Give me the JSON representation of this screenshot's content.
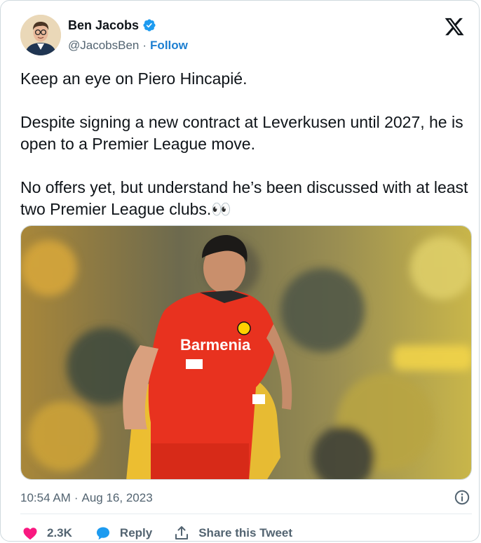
{
  "author": {
    "name": "Ben Jacobs",
    "handle": "@JacobsBen",
    "separator": "·",
    "follow_label": "Follow",
    "verified_color": "#1d9bf0"
  },
  "tweet": {
    "paragraphs": [
      "Keep an eye on Piero Hincapié.",
      "Despite signing a new contract at Leverkusen until 2027, he is open to a Premier League move.",
      "No offers yet, but understand he’s been discussed with at least two Premier League clubs.👀"
    ],
    "media": {
      "shirt_sponsor": "Barmenia"
    },
    "time": "10:54 AM",
    "time_separator": "·",
    "date": "Aug 16, 2023"
  },
  "actions": {
    "likes": "2.3K",
    "reply_label": "Reply",
    "share_label": "Share this Tweet",
    "like_color": "#f91880",
    "reply_color": "#1d9bf0"
  },
  "icons": [
    "verified-badge-icon",
    "x-logo-icon",
    "info-icon",
    "heart-icon",
    "reply-bubble-icon",
    "share-icon"
  ]
}
